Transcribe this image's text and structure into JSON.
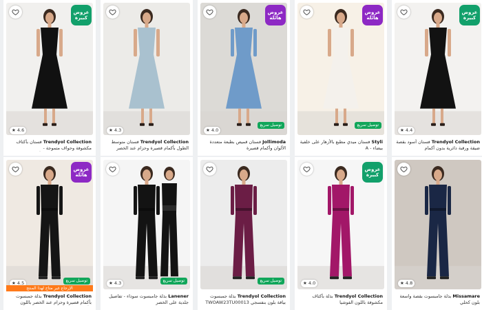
{
  "products": [
    {
      "brand": "Trendyol Collection",
      "title": "فستان بأكتاف مكشوفة وحواف متموجة - TPRSS24ES00048 بلون أسود",
      "rating": "4.6",
      "badge": {
        "lines": [
          "عروض",
          "كبيرة"
        ],
        "color": "#12a06b"
      },
      "shipping": "",
      "promo": "",
      "dress_color": "#111111",
      "bg_color": "#f1f0ee"
    },
    {
      "brand": "Trendyol Collection",
      "title": "فستان متوسط الطول بأكمام قصيرة وحزام عند الخصر",
      "rating": "4.3",
      "badge": null,
      "shipping": "",
      "promo": "",
      "dress_color": "#a9c1cf",
      "bg_color": "#ecebe8"
    },
    {
      "brand": "Jollimoda",
      "title": "فستان قميص بطبعة متعددة الألوان وأكمام قصيرة",
      "rating": "4.0",
      "badge": {
        "lines": [
          "عروض",
          "هائلة"
        ],
        "color": "#8d29c4"
      },
      "shipping": "توصيل سريع",
      "promo": "",
      "dress_color": "#6f9bc9",
      "bg_color": "#dcdad6"
    },
    {
      "brand": "Styli",
      "title": "فستان ميدي مطبع بالأزهار على خلفية بيضاء - A",
      "rating": "",
      "badge": {
        "lines": [
          "عروض",
          "هائلة"
        ],
        "color": "#8d29c4"
      },
      "shipping": "توصيل سريع",
      "promo": "",
      "dress_color": "#f4f1ec",
      "bg_color": "#f7f1e7"
    },
    {
      "brand": "Trendyol Collection",
      "title": "فستان أسود بقصة ضيقة ورقبة دائرية بدون أكمام",
      "rating": "4.4",
      "badge": {
        "lines": [
          "عروض",
          "كبيرة"
        ],
        "color": "#12a06b"
      },
      "shipping": "",
      "promo": "",
      "dress_color": "#121212",
      "bg_color": "#f3f2f0"
    },
    {
      "brand": "Trendyol Collection",
      "title": "بذلة جمبسوت بأكمام قصيرة وحزام عند الخصر باللون الأسود",
      "rating": "4.5",
      "badge": {
        "lines": [
          "عروض",
          "هائلة"
        ],
        "color": "#8d29c4"
      },
      "shipping": "توصيل سريع",
      "promo": "الإرجاع غير متاح لهذا المنتج",
      "dress_color": "#151515",
      "bg_color": "#efe9e2"
    },
    {
      "brand": "Lanener",
      "title": "بذلة جامبسوت سوداء - تفاصيل جلدية على الخصر",
      "rating": "4.3",
      "badge": null,
      "shipping": "توصيل سريع",
      "promo": "",
      "dress_color": "#131313",
      "bg_color": "#f5f5f5"
    },
    {
      "brand": "Trendyol Collection",
      "title": "بذلة جمبسوت بياقة بلون بنفسجي TWOAW23TU00013",
      "rating": "",
      "badge": null,
      "shipping": "توصيل سريع",
      "promo": "",
      "dress_color": "#6b1d45",
      "bg_color": "#ececec"
    },
    {
      "brand": "Trendyol Collection",
      "title": "بذلة بأكتاف مكشوفة باللون الفوشيا TPRSS23TU00070",
      "rating": "4.0",
      "badge": {
        "lines": [
          "عروض",
          "كبيرة"
        ],
        "color": "#12a06b"
      },
      "shipping": "",
      "promo": "",
      "dress_color": "#a21768",
      "bg_color": "#f6f6f6"
    },
    {
      "brand": "Missamare",
      "title": "بذلة جامبسوت بقصة واسعة بلون كحلي",
      "rating": "4.8",
      "badge": null,
      "shipping": "",
      "promo": "",
      "dress_color": "#1a2745",
      "bg_color": "#cfc8c1"
    }
  ]
}
